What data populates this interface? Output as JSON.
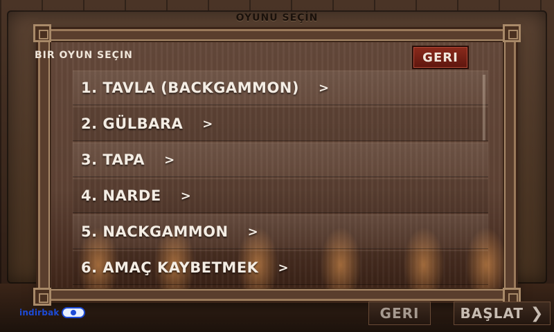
{
  "screen_title": "OYUNU SEÇİN",
  "dialog": {
    "header": "BIR OYUN SEÇIN",
    "back_label": "GERI",
    "items": [
      {
        "label": "1. TAVLA (BACKGAMMON)",
        "chevron": ">"
      },
      {
        "label": "2. GÜLBARA",
        "chevron": ">"
      },
      {
        "label": "3. TAPA",
        "chevron": ">"
      },
      {
        "label": "4. NARDE",
        "chevron": ">"
      },
      {
        "label": "5. NACKGAMMON",
        "chevron": ">"
      },
      {
        "label": "6. AMAÇ KAYBETMEK",
        "chevron": ">"
      }
    ]
  },
  "bottom_bar": {
    "brand_text": "indirbak",
    "back_label": "GERI",
    "start_label": "BAŞLAT",
    "start_arrow": "❯"
  },
  "colors": {
    "accent_red": "#8a2a1c",
    "text_light": "#f4ede4",
    "brand_blue": "#1d4bd8"
  }
}
